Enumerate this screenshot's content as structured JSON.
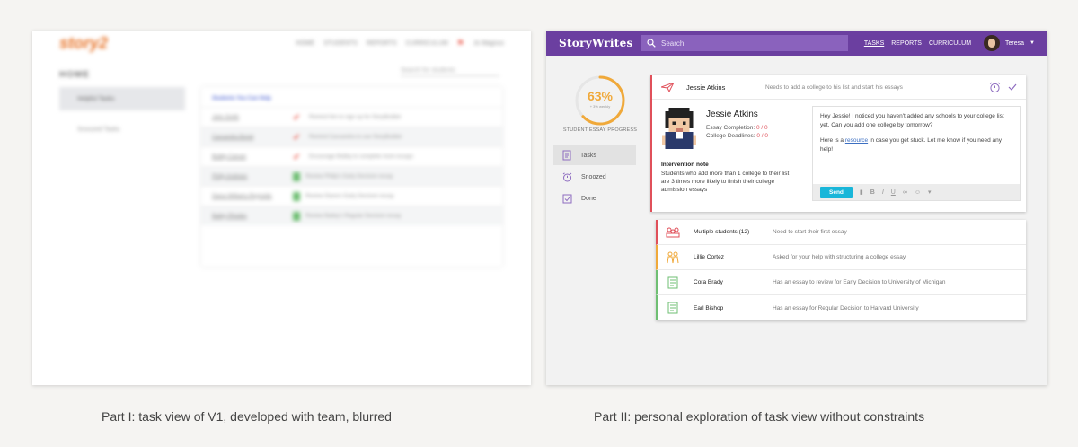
{
  "captions": {
    "left": "Part I: task view of V1, developed with team, blurred",
    "right": "Part II: personal exploration of task view without constraints"
  },
  "v1": {
    "logo": "story2",
    "nav": [
      "HOME",
      "STUDENTS",
      "REPORTS",
      "CURRICULUM"
    ],
    "user": "Jo Magnus",
    "title": "HOME",
    "search_placeholder": "Search for students",
    "sidebar": [
      "Helpful Tasks",
      "Snoozed Tasks"
    ],
    "panel_title": "Students You Can Help",
    "rows": [
      {
        "name": "John Smith",
        "text": "Remind him to sign up for StoryBuilder"
      },
      {
        "name": "Cassandra Bonet",
        "text": "Remind Cassandra to use StoryBuilder"
      },
      {
        "name": "Bobby Carson",
        "text": "Encourage Bobby to complete more essays"
      },
      {
        "name": "Philip Andrews",
        "text": "Review Philip's Early Decision essay"
      },
      {
        "name": "Diana Williams-Reynolds",
        "text": "Review Diana's Early Decision essay"
      },
      {
        "name": "Bailey Rhodes",
        "text": "Review Bailey's Regular Decision essay"
      }
    ]
  },
  "app": {
    "brand": "StoryWrites",
    "search_placeholder": "Search",
    "nav": {
      "tasks": "TASKS",
      "reports": "REPORTS",
      "curriculum": "CURRICULUM"
    },
    "user_name": "Teresa",
    "progress": {
      "percent": "63%",
      "weekly": "+ 3% weekly",
      "label": "STUDENT ESSAY PROGRESS",
      "value": 0.63
    },
    "sidebar": [
      {
        "label": "Tasks",
        "icon": "document-icon"
      },
      {
        "label": "Snoozed",
        "icon": "alarm-clock-icon"
      },
      {
        "label": "Done",
        "icon": "checkbox-icon"
      }
    ],
    "main_task": {
      "name": "Jessie Atkins",
      "description": "Needs to add a college to his list and start his essays",
      "student_name": "Jessie Atkins",
      "essay_completion_label": "Essay Completion:",
      "essay_completion_value": "0 / 0",
      "college_deadlines_label": "College Deadlines:",
      "college_deadlines_value": "0 / 0",
      "intervention_title": "Intervention note",
      "intervention_text": "Students who add more than 1 college to their list are 3 times more likely to finish their college admission essays",
      "message_line1": "Hey Jessie! I noticed you haven't added any schools to your college list yet. Can you add one college by tomorrow?",
      "message_line2_pre": "Here is a",
      "message_link": "resource",
      "message_line2_post": "in case you get stuck. Let me know if you need any help!",
      "send_label": "Send"
    },
    "tasks": [
      {
        "name": "Multiple students (12)",
        "description": "Need to start their first essay",
        "color": "#e0505a",
        "icon": "group-icon"
      },
      {
        "name": "Lillie Cortez",
        "description": "Asked for your help with structuring a college essay",
        "color": "#f0a93a",
        "icon": "help-people-icon"
      },
      {
        "name": "Cora Brady",
        "description": "Has an essay to review for Early Decision to University of Michigan",
        "color": "#6fbf73",
        "icon": "essay-icon"
      },
      {
        "name": "Earl Bishop",
        "description": "Has an essay for Regular Decision to Harvard University",
        "color": "#6fbf73",
        "icon": "essay-icon"
      }
    ]
  }
}
